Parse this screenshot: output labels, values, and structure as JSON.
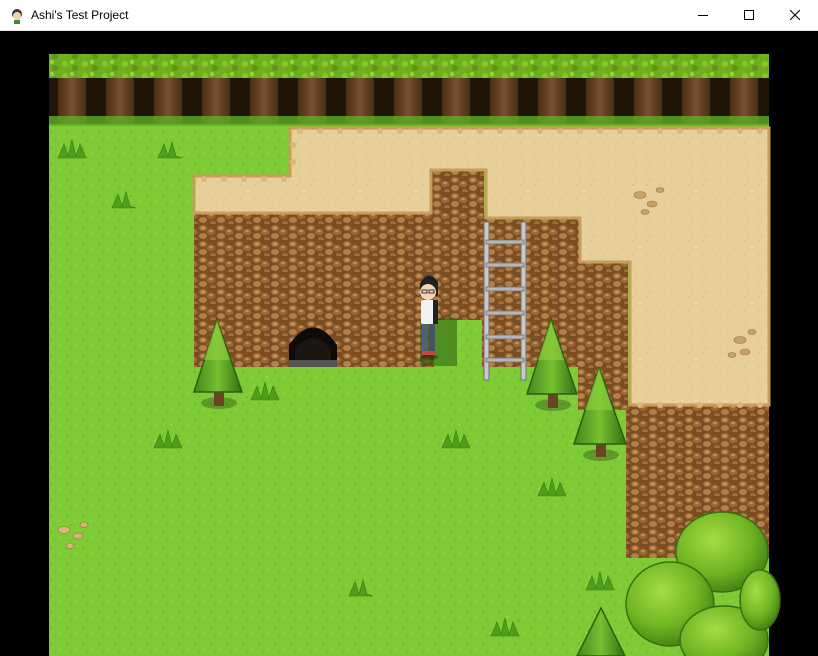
{
  "window": {
    "title": "Ashi's Test Project",
    "app_icon": "rpg-maker-character-icon",
    "controls": {
      "minimize": "minimize-icon",
      "maximize": "maximize-icon",
      "close": "close-icon"
    }
  },
  "scene": {
    "type": "top-down RPG map",
    "terrain": [
      "grass",
      "dirt-plateau",
      "rock-cliff",
      "forest-edge"
    ],
    "objects": [
      "cave-entrance",
      "metal-ladder",
      "pine-tree",
      "round-bush-tree",
      "player-character",
      "grass-tuft",
      "pebbles"
    ],
    "colors": {
      "grass": "#7ecb36",
      "grass_dark": "#5fae24",
      "dirt": "#e6cf98",
      "rock": "#8a5a2b",
      "rock_dark": "#5a3616",
      "canopy": "#6fae1e",
      "trunk": "#6b4424",
      "letterbox": "#000000"
    }
  }
}
